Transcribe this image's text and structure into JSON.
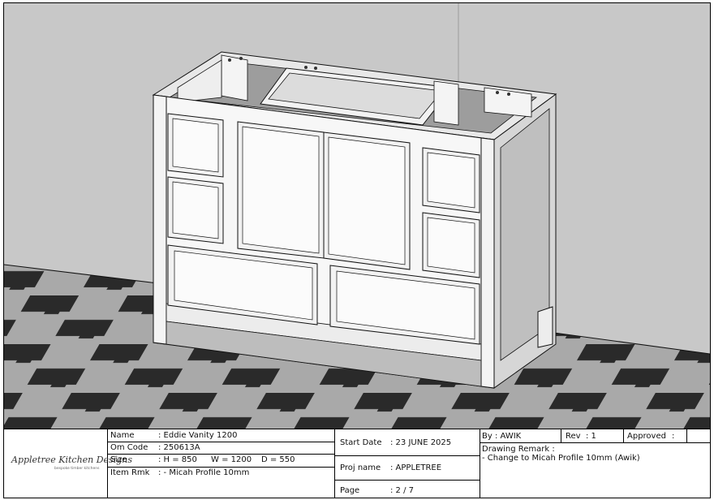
{
  "logo": {
    "brand": "Appletree Kitchen Designs",
    "tagline": "bespoke timber kitchens"
  },
  "item": {
    "name_label": "Name",
    "name_value": ": Eddie Vanity 1200",
    "om_code_label": "Om Code",
    "om_code_value": ": 250613A",
    "size_label": "Size",
    "size_h": ": H = 850",
    "size_w": "W = 1200",
    "size_d": "D = 550",
    "rmk_label": "Item Rmk",
    "rmk_value": ": - Micah Profile 10mm"
  },
  "project": {
    "start_date_label": "Start Date",
    "start_date_value": ": 23 JUNE 2025",
    "proj_name_label": "Proj name",
    "proj_name_value": ": APPLETREE",
    "page_label": "Page",
    "page_value": ": 2 / 7"
  },
  "revision": {
    "by_label": "By",
    "by_value": ": AWIK",
    "rev_label": "Rev",
    "rev_value": ": 1",
    "approved_label": "Approved",
    "approved_value": ":",
    "remark_label": "Drawing Remark :",
    "remark_value": "- Change to Micah Profile 10mm (Awik)"
  },
  "colors": {
    "wall": "#c8c8c8",
    "floor_light": "#a9a9a9",
    "floor_dark": "#2a2a2a",
    "cabinet": "#f7f7f7",
    "outline": "#111111"
  }
}
